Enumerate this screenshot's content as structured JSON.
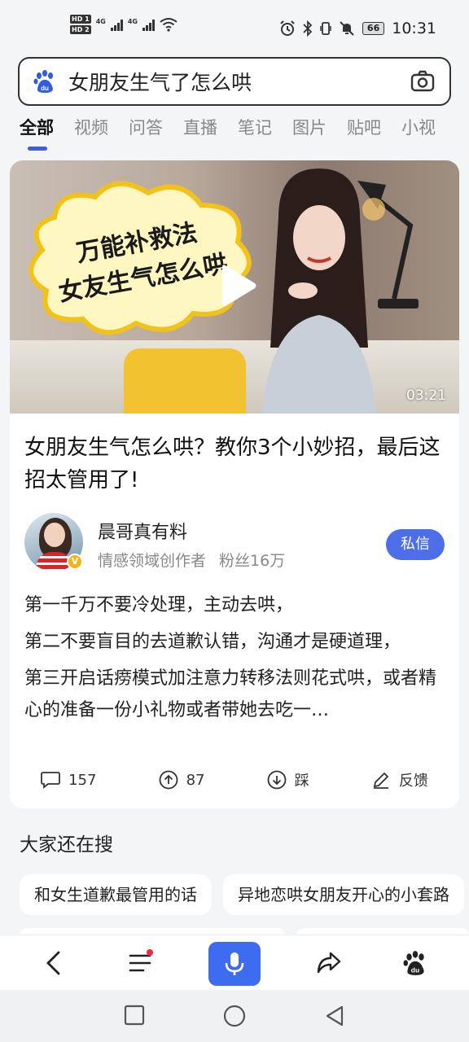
{
  "status_bar": {
    "hd1": "HD 1",
    "hd2": "HD 2",
    "net1": "4G",
    "net2": "4G",
    "battery": "66",
    "time": "10:31"
  },
  "search": {
    "query": "女朋友生气了怎么哄"
  },
  "tabs": [
    {
      "label": "全部",
      "active": true
    },
    {
      "label": "视频"
    },
    {
      "label": "问答"
    },
    {
      "label": "直播"
    },
    {
      "label": "笔记"
    },
    {
      "label": "图片"
    },
    {
      "label": "贴吧"
    },
    {
      "label": "小视"
    }
  ],
  "result": {
    "thumbnail_caption": [
      "万能补救法",
      "女友生气怎么哄"
    ],
    "duration": "03:21",
    "title": "女朋友生气怎么哄？教你3个小妙招，最后这招太管用了!",
    "author": {
      "name": "晨哥真有料",
      "role": "情感领域创作者",
      "fans": "粉丝16万",
      "verified_badge": "V"
    },
    "message_button": "私信",
    "paragraphs": [
      "第一千万不要冷处理，主动去哄，",
      "第二不要盲目的去道歉认错，沟通才是硬道理，",
      "第三开启话痨模式加注意力转移法则花式哄，或者精心的准备一份小礼物或者带她去吃一…"
    ],
    "actions": {
      "comments": "157",
      "likes": "87",
      "dislike": "踩",
      "feedback": "反馈"
    }
  },
  "others_searching": {
    "title": "大家还在搜",
    "chips": [
      "和女生道歉最管用的话",
      "异地恋哄女朋友开心的小套路"
    ]
  },
  "colors": {
    "accent": "#3d6cf0",
    "tab_indicator": "#3d5ed8",
    "message_button": "#4d6ee8",
    "notification_dot": "#f0283c"
  }
}
